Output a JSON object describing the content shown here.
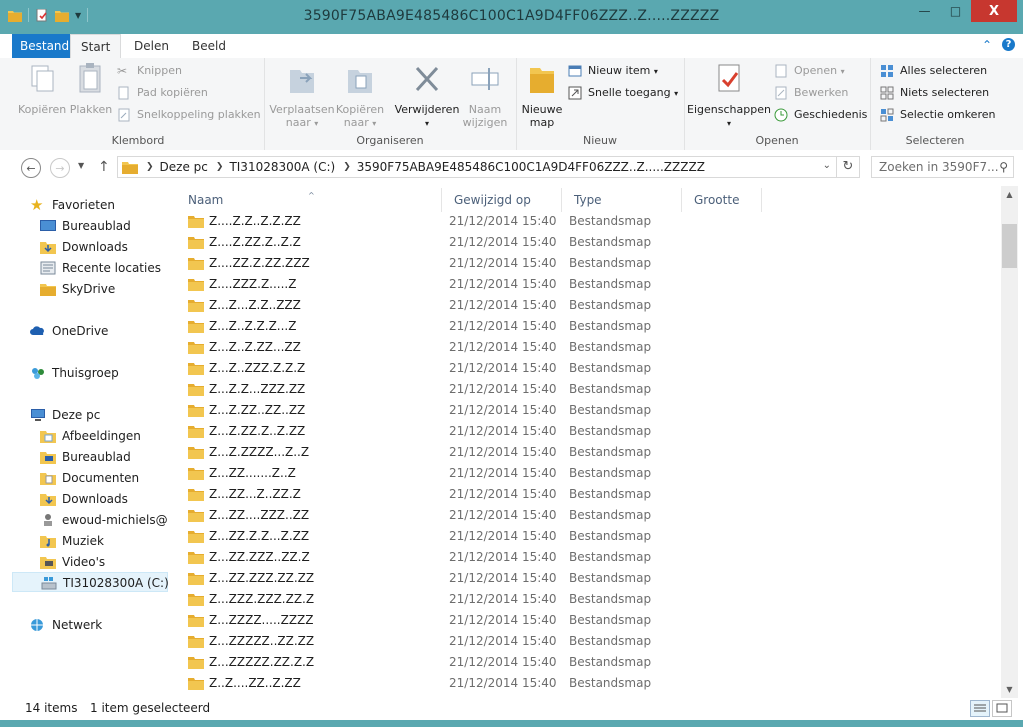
{
  "window": {
    "title": "3590F75ABA9E485486C100C1A9D4FF06ZZZ..Z.....ZZZZZ",
    "minimize": "—",
    "maximize": "□",
    "close": "X"
  },
  "tabs": {
    "file": "Bestand",
    "start": "Start",
    "share": "Delen",
    "view": "Beeld"
  },
  "ribbon": {
    "clipboard": {
      "label": "Klembord",
      "copy": "Kopiëren",
      "paste": "Plakken",
      "cut": "Knippen",
      "copy_path": "Pad kopiëren",
      "paste_shortcut": "Snelkoppeling plakken"
    },
    "organize": {
      "label": "Organiseren",
      "move_to": "Verplaatsen naar",
      "copy_to": "Kopiëren naar",
      "delete": "Verwijderen",
      "rename": "Naam wijzigen"
    },
    "new": {
      "label": "Nieuw",
      "new_folder": "Nieuwe map",
      "new_item": "Nieuw item",
      "easy_access": "Snelle toegang"
    },
    "open": {
      "label": "Openen",
      "properties": "Eigenschappen",
      "open": "Openen",
      "edit": "Bewerken",
      "history": "Geschiedenis"
    },
    "select": {
      "label": "Selecteren",
      "select_all": "Alles selecteren",
      "select_none": "Niets selecteren",
      "invert": "Selectie omkeren"
    }
  },
  "address": {
    "segments": [
      "Deze pc",
      "TI31028300A (C:)",
      "3590F75ABA9E485486C100C1A9D4FF06ZZZ..Z.....ZZZZZ"
    ],
    "search_placeholder": "Zoeken in 3590F7..."
  },
  "nav": {
    "favorites": "Favorieten",
    "fav_items": [
      "Bureaublad",
      "Downloads",
      "Recente locaties",
      "SkyDrive"
    ],
    "onedrive": "OneDrive",
    "homegroup": "Thuisgroep",
    "thispc": "Deze pc",
    "pc_items": [
      "Afbeeldingen",
      "Bureaublad",
      "Documenten",
      "Downloads",
      "ewoud-michiels@hc",
      "Muziek",
      "Video's",
      "TI31028300A (C:)"
    ],
    "network": "Netwerk"
  },
  "columns": {
    "name": "Naam",
    "modified": "Gewijzigd op",
    "type": "Type",
    "size": "Grootte"
  },
  "files": [
    {
      "name": "Z....Z.Z..Z.Z.ZZ",
      "date": "21/12/2014 15:40",
      "type": "Bestandsmap"
    },
    {
      "name": "Z....Z.ZZ.Z..Z.Z",
      "date": "21/12/2014 15:40",
      "type": "Bestandsmap"
    },
    {
      "name": "Z....ZZ.Z.ZZ.ZZZ",
      "date": "21/12/2014 15:40",
      "type": "Bestandsmap"
    },
    {
      "name": "Z....ZZZ.Z.....Z",
      "date": "21/12/2014 15:40",
      "type": "Bestandsmap"
    },
    {
      "name": "Z...Z...Z.Z..ZZZ",
      "date": "21/12/2014 15:40",
      "type": "Bestandsmap"
    },
    {
      "name": "Z...Z..Z.Z.Z...Z",
      "date": "21/12/2014 15:40",
      "type": "Bestandsmap"
    },
    {
      "name": "Z...Z..Z.ZZ...ZZ",
      "date": "21/12/2014 15:40",
      "type": "Bestandsmap"
    },
    {
      "name": "Z...Z..ZZZ.Z.Z.Z",
      "date": "21/12/2014 15:40",
      "type": "Bestandsmap"
    },
    {
      "name": "Z...Z.Z...ZZZ.ZZ",
      "date": "21/12/2014 15:40",
      "type": "Bestandsmap"
    },
    {
      "name": "Z...Z.ZZ..ZZ..ZZ",
      "date": "21/12/2014 15:40",
      "type": "Bestandsmap"
    },
    {
      "name": "Z...Z.ZZ.Z..Z.ZZ",
      "date": "21/12/2014 15:40",
      "type": "Bestandsmap"
    },
    {
      "name": "Z...Z.ZZZZ...Z..Z",
      "date": "21/12/2014 15:40",
      "type": "Bestandsmap"
    },
    {
      "name": "Z...ZZ.......Z..Z",
      "date": "21/12/2014 15:40",
      "type": "Bestandsmap"
    },
    {
      "name": "Z...ZZ...Z..ZZ.Z",
      "date": "21/12/2014 15:40",
      "type": "Bestandsmap"
    },
    {
      "name": "Z...ZZ....ZZZ..ZZ",
      "date": "21/12/2014 15:40",
      "type": "Bestandsmap"
    },
    {
      "name": "Z...ZZ.Z.Z...Z.ZZ",
      "date": "21/12/2014 15:40",
      "type": "Bestandsmap"
    },
    {
      "name": "Z...ZZ.ZZZ..ZZ.Z",
      "date": "21/12/2014 15:40",
      "type": "Bestandsmap"
    },
    {
      "name": "Z...ZZ.ZZZ.ZZ.ZZ",
      "date": "21/12/2014 15:40",
      "type": "Bestandsmap"
    },
    {
      "name": "Z...ZZZ.ZZZ.ZZ.Z",
      "date": "21/12/2014 15:40",
      "type": "Bestandsmap"
    },
    {
      "name": "Z...ZZZZ.....ZZZZ",
      "date": "21/12/2014 15:40",
      "type": "Bestandsmap"
    },
    {
      "name": "Z...ZZZZZ..ZZ.ZZ",
      "date": "21/12/2014 15:40",
      "type": "Bestandsmap"
    },
    {
      "name": "Z...ZZZZZ.ZZ.Z.Z",
      "date": "21/12/2014 15:40",
      "type": "Bestandsmap"
    },
    {
      "name": "Z..Z....ZZ..Z.ZZ",
      "date": "21/12/2014 15:40",
      "type": "Bestandsmap"
    }
  ],
  "status": {
    "items": "14 items",
    "selected": "1 item geselecteerd"
  },
  "colors": {
    "title_bar": "#5aa8b0",
    "file_tab": "#1979ca",
    "close": "#c7372f",
    "folder": "#f2c650"
  }
}
